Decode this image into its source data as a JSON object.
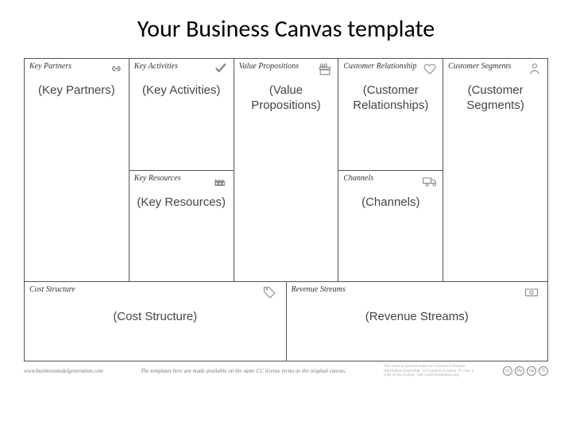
{
  "title": "Your Business Canvas template",
  "blocks": {
    "keyPartners": {
      "label": "Key Partners",
      "placeholder": "(Key Partners)"
    },
    "keyActivities": {
      "label": "Key Activities",
      "placeholder": "(Key Activities)"
    },
    "keyResources": {
      "label": "Key Resources",
      "placeholder": "(Key Resources)"
    },
    "valueProps": {
      "label": "Value Propositions",
      "placeholder": "(Value Propositions)"
    },
    "custRel": {
      "label": "Customer Relationship",
      "placeholder": "(Customer Relationships)"
    },
    "channels": {
      "label": "Channels",
      "placeholder": "(Channels)"
    },
    "custSeg": {
      "label": "Customer Segments",
      "placeholder": "(Customer Segments)"
    },
    "cost": {
      "label": "Cost Structure",
      "placeholder": "(Cost Structure)"
    },
    "revenue": {
      "label": "Revenue Streams",
      "placeholder": "(Revenue Streams)"
    }
  },
  "footer": {
    "url": "www.businessmodelgeneration.com",
    "license": "The templates here are made available on the same CC license terms as the original canvas.",
    "disclaimer": "This work is licensed under the Creative Commons Attribution-ShareAlike 3.0 Unported License. To view a copy of this license, visit creativecommons.org.",
    "cc": [
      "cc",
      "by",
      "sa",
      "©"
    ]
  }
}
